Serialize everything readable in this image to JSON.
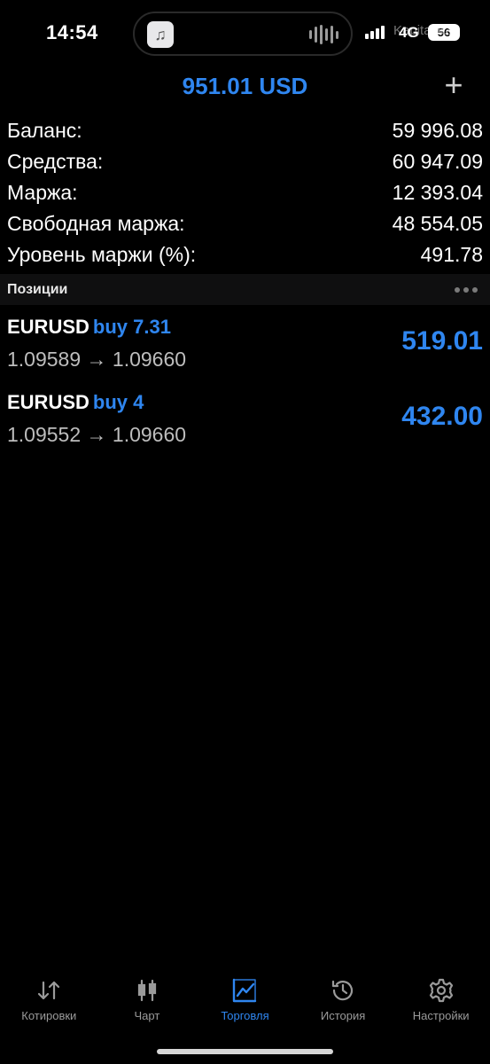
{
  "status_bar": {
    "time": "14:54",
    "network": "4G",
    "battery": "56",
    "watermark": "Kapital.kz"
  },
  "header": {
    "title": "951.01 USD",
    "add_icon": "plus-icon"
  },
  "summary": [
    {
      "label": "Баланс:",
      "value": "59 996.08"
    },
    {
      "label": "Средства:",
      "value": "60 947.09"
    },
    {
      "label": "Маржа:",
      "value": "12 393.04"
    },
    {
      "label": "Свободная маржа:",
      "value": "48 554.05"
    },
    {
      "label": "Уровень маржи (%):",
      "value": "491.78"
    }
  ],
  "positions_section": {
    "title": "Позиции",
    "more_icon": "ellipsis-icon"
  },
  "positions": [
    {
      "symbol": "EURUSD",
      "side": "buy 7.31",
      "prices": "1.09589 → 1.09660",
      "profit": "519.01"
    },
    {
      "symbol": "EURUSD",
      "side": "buy 4",
      "prices": "1.09552 → 1.09660",
      "profit": "432.00"
    }
  ],
  "tabs": [
    {
      "label": "Котировки",
      "icon": "quotes-arrows-icon",
      "active": false
    },
    {
      "label": "Чарт",
      "icon": "candlestick-icon",
      "active": false
    },
    {
      "label": "Торговля",
      "icon": "trade-chart-icon",
      "active": true
    },
    {
      "label": "История",
      "icon": "history-clock-icon",
      "active": false
    },
    {
      "label": "Настройки",
      "icon": "gear-icon",
      "active": false
    }
  ],
  "colors": {
    "accent": "#2f86f0",
    "background": "#000000",
    "section_header": "#0f0f10"
  }
}
